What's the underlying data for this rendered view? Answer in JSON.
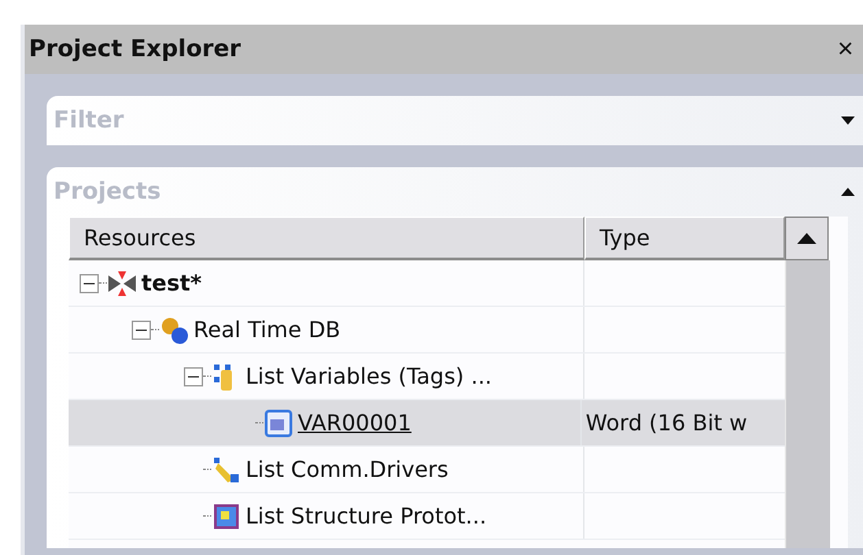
{
  "panel": {
    "title": "Project Explorer",
    "close": "×"
  },
  "sections": [
    {
      "title": "Filter",
      "expanded": false
    },
    {
      "title": "Projects",
      "expanded": true
    }
  ],
  "table": {
    "columns": [
      "Resources",
      "Type"
    ],
    "rows": [
      {
        "label": "test*",
        "kind": "project",
        "bold": true,
        "expanded": true,
        "selected": false,
        "children": [
          {
            "label": "Real Time DB",
            "kind": "database",
            "bold": false,
            "expanded": true,
            "selected": false,
            "children": [
              {
                "label": "List Variables (Tags) ...",
                "kind": "variables",
                "bold": false,
                "expanded": true,
                "selected": false,
                "children": [
                  {
                    "label": "VAR00001",
                    "kind": "variable",
                    "bold": false,
                    "selected": true,
                    "type": "Word (16 Bit w"
                  }
                ]
              },
              {
                "label": "List Comm.Drivers",
                "kind": "drivers",
                "bold": false,
                "selected": false
              },
              {
                "label": "List Structure Protot...",
                "kind": "structures",
                "bold": false,
                "selected": false
              }
            ]
          }
        ]
      }
    ]
  }
}
